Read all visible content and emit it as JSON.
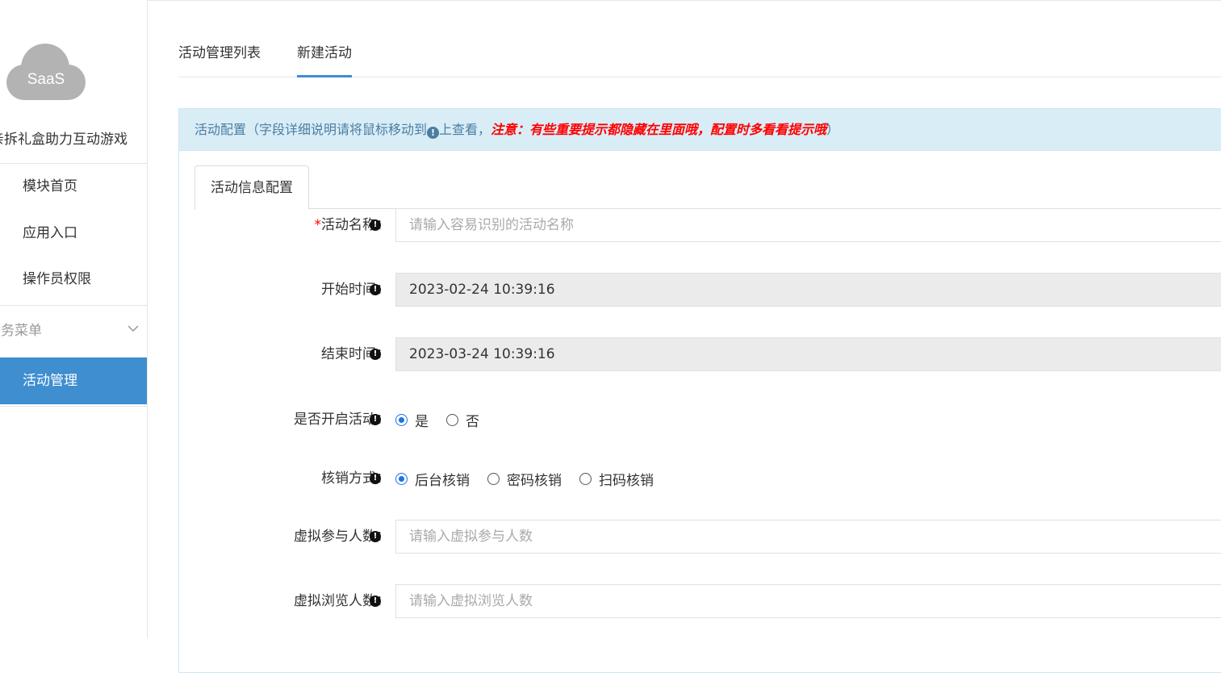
{
  "sidebar": {
    "logo_text": "SaaS",
    "app_name": "亲拆礼盒助力互动游戏",
    "items": [
      {
        "label": "模块首页"
      },
      {
        "label": "应用入口"
      },
      {
        "label": "操作员权限"
      }
    ],
    "group_label": "服务菜单",
    "active_item": {
      "label": "活动管理"
    }
  },
  "tabs": [
    {
      "label": "活动管理列表"
    },
    {
      "label": "新建活动"
    }
  ],
  "panel": {
    "head_prefix": "活动配置（字段详细说明请将鼠标移动到",
    "head_middle": "上查看，",
    "head_warning": "注意：有些重要提示都隐藏在里面哦，配置时多看看提示哦",
    "head_suffix": "）",
    "inner_tab": "活动信息配置"
  },
  "form": {
    "activity_name": {
      "required_mark": "*",
      "label": "活动名称：",
      "placeholder": "请输入容易识别的活动名称"
    },
    "start_time": {
      "label": "开始时间：",
      "value": "2023-02-24 10:39:16"
    },
    "end_time": {
      "label": "结束时间：",
      "value": "2023-03-24 10:39:16"
    },
    "enable": {
      "label": "是否开启活动：",
      "options": [
        "是",
        "否"
      ],
      "selected": "是"
    },
    "verify": {
      "label": "核销方式：",
      "options": [
        "后台核销",
        "密码核销",
        "扫码核销"
      ],
      "selected": "后台核销"
    },
    "virtual_participants": {
      "label": "虚拟参与人数：",
      "placeholder": "请输入虚拟参与人数"
    },
    "virtual_views": {
      "label": "虚拟浏览人数：",
      "placeholder": "请输入虚拟浏览人数"
    }
  },
  "colors": {
    "accent": "#3e8ed0",
    "warning": "#ff0000",
    "panel_head_bg": "#d9edf7"
  }
}
